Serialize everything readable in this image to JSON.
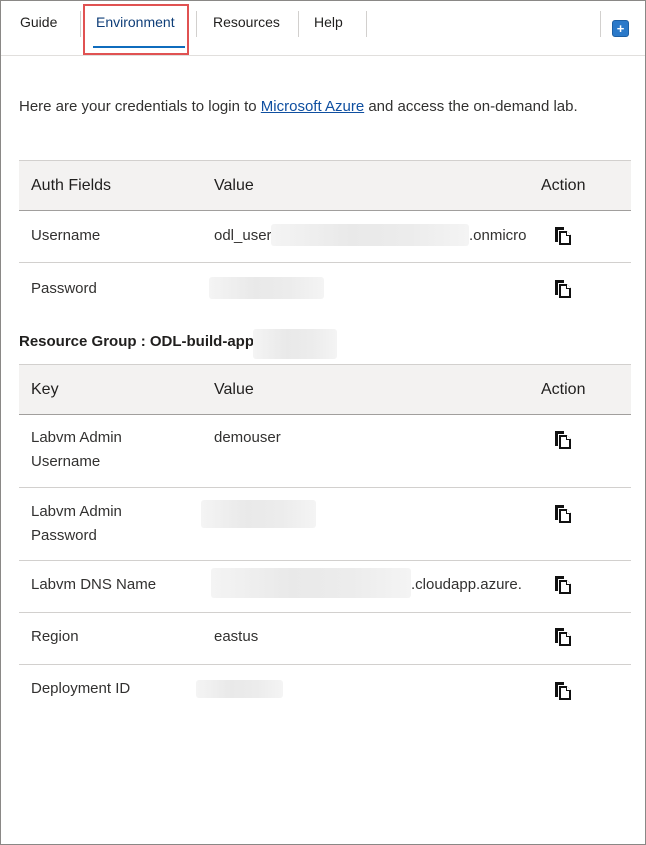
{
  "tabs": [
    {
      "label": "Guide"
    },
    {
      "label": "Environment"
    },
    {
      "label": "Resources"
    },
    {
      "label": "Help"
    }
  ],
  "intro": {
    "before": "Here are your credentials to login to ",
    "link": "Microsoft Azure",
    "after": " and access the on-demand lab."
  },
  "auth_table": {
    "headers": {
      "field": "Auth Fields",
      "value": "Value",
      "action": "Action"
    },
    "rows": [
      {
        "field": "Username",
        "value_prefix": "odl_user",
        "value_suffix": ".onmicro"
      },
      {
        "field": "Password"
      }
    ]
  },
  "resource_group": {
    "title": "Resource Group : ODL-build-apps"
  },
  "resource_table": {
    "headers": {
      "key": "Key",
      "value": "Value",
      "action": "Action"
    },
    "rows": [
      {
        "key_line1": "Labvm Admin",
        "key_line2": "Username",
        "value": "demouser"
      },
      {
        "key_line1": "Labvm Admin",
        "key_line2": "Password"
      },
      {
        "key": "Labvm DNS Name",
        "value_suffix": ".cloudapp.azure."
      },
      {
        "key": "Region",
        "value": "eastus"
      },
      {
        "key": "Deployment ID"
      }
    ]
  },
  "icons": {
    "copy": "copy-icon",
    "corner": "expand-icon"
  }
}
